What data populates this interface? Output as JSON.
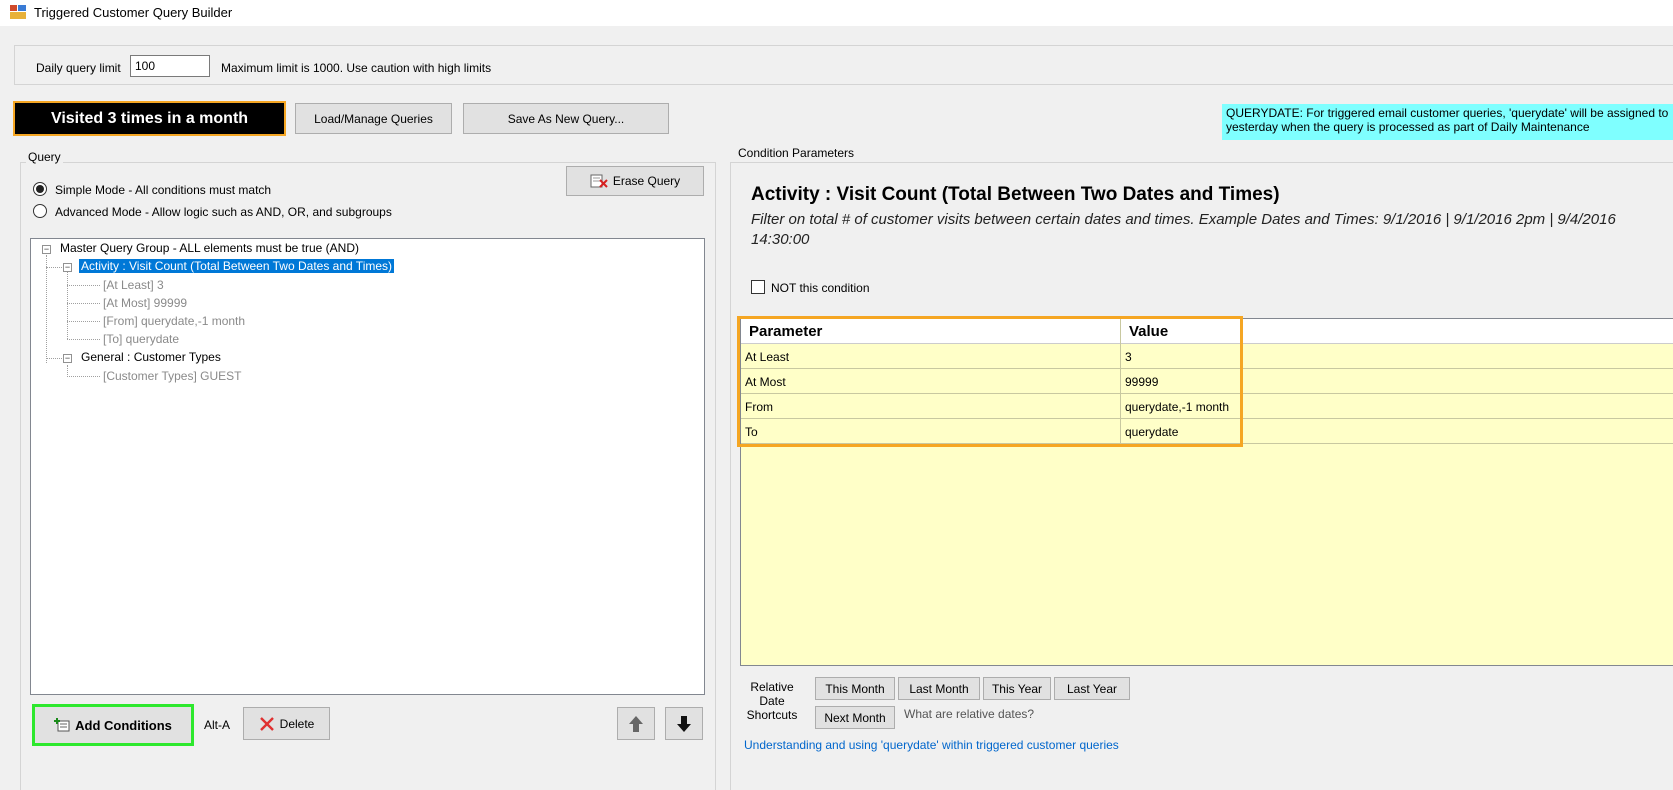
{
  "window": {
    "title": "Triggered Customer Query Builder",
    "icon": "app-window-icon"
  },
  "limits": {
    "label": "Daily query limit",
    "value": "100",
    "note": "Maximum limit is 1000. Use caution with high limits"
  },
  "toolbar": {
    "query_name": "Visited 3 times in a month",
    "load_label": "Load/Manage Queries",
    "save_label": "Save As New Query..."
  },
  "querydate_note": "QUERYDATE: For triggered email customer queries, 'querydate' will be assigned to yesterday when the query is processed as part of Daily Maintenance",
  "query": {
    "group_label": "Query",
    "simple_mode": "Simple Mode - All conditions must match",
    "advanced_mode": "Advanced Mode - Allow logic such as AND, OR, and subgroups",
    "erase_label": "Erase Query",
    "tree": {
      "root": "Master Query Group - ALL elements must be true (AND)",
      "condition1": "Activity : Visit Count (Total Between Two Dates and Times)",
      "condition1_params": [
        "[At Least] 3",
        "[At Most] 99999",
        "[From] querydate,-1 month",
        "[To] querydate"
      ],
      "condition2": "General : Customer Types",
      "condition2_params": [
        "[Customer Types] GUEST"
      ]
    },
    "add_label": "Add Conditions",
    "add_shortcut": "Alt-A",
    "delete_label": "Delete"
  },
  "condition": {
    "group_label": "Condition Parameters",
    "title": "Activity : Visit Count (Total Between Two Dates and Times)",
    "description": "Filter on total # of customer visits between certain dates and times.  Example Dates and Times: 9/1/2016 | 9/1/2016 2pm | 9/4/2016 14:30:00",
    "not_label": "NOT this condition",
    "grid": {
      "headers": [
        "Parameter",
        "Value"
      ],
      "rows": [
        {
          "param": "At Least",
          "value": "3"
        },
        {
          "param": "At Most",
          "value": "99999"
        },
        {
          "param": "From",
          "value": "querydate,-1 month"
        },
        {
          "param": "To",
          "value": "querydate"
        }
      ]
    },
    "shortcuts": {
      "label": "Relative Date Shortcuts",
      "this_month": "This Month",
      "last_month": "Last Month",
      "this_year": "This Year",
      "last_year": "Last Year",
      "next_month": "Next Month",
      "what_relative": "What are relative dates?"
    },
    "querydate_link": "Understanding and using 'querydate' within triggered customer queries"
  },
  "colors": {
    "selection": "#0078d7",
    "grid_bg": "#ffffc8",
    "highlight_orange": "#f5a623",
    "highlight_green": "#2de82d",
    "note_bg": "#7fffff"
  }
}
